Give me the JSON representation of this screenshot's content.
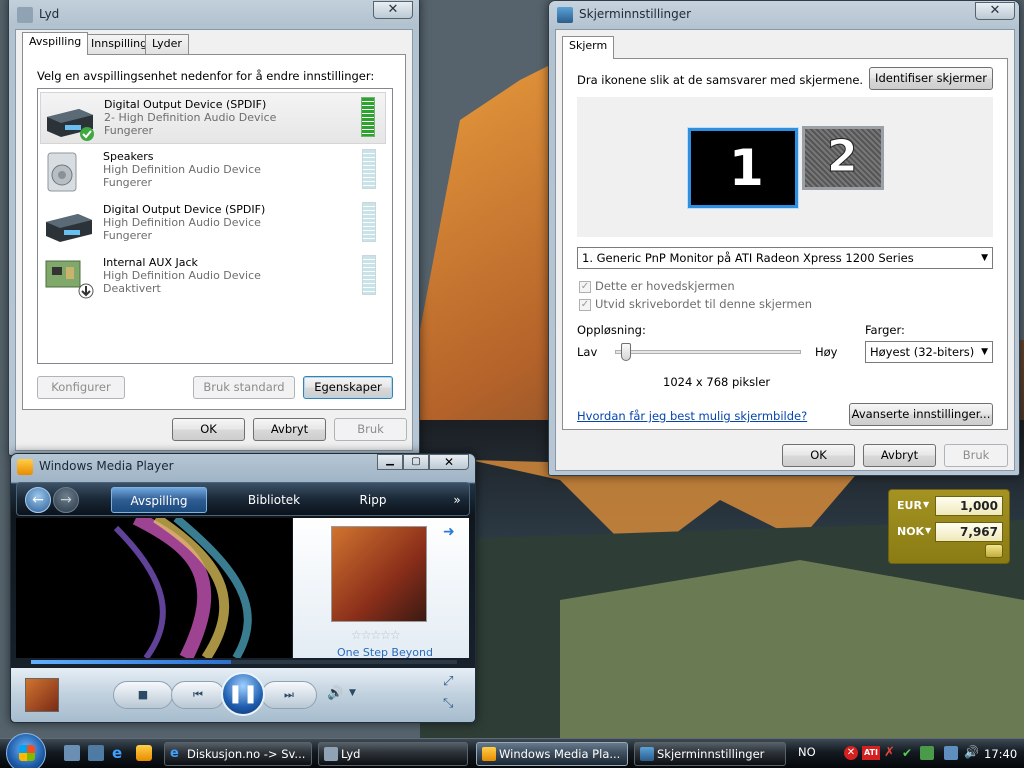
{
  "sound_dialog": {
    "title": "Lyd",
    "tabs": [
      "Avspilling",
      "Innspilling",
      "Lyder"
    ],
    "instruction": "Velg en avspillingsenhet nedenfor for å endre innstillinger:",
    "devices": [
      {
        "name": "Digital Output Device (SPDIF)",
        "desc": "2- High Definition Audio Device",
        "status": "Fungerer",
        "icon": "spdif-device-icon",
        "selected": true,
        "default": true
      },
      {
        "name": "Speakers",
        "desc": "High Definition Audio Device",
        "status": "Fungerer",
        "icon": "speaker-icon"
      },
      {
        "name": "Digital Output Device (SPDIF)",
        "desc": "High Definition Audio Device",
        "status": "Fungerer",
        "icon": "spdif-device-icon"
      },
      {
        "name": "Internal AUX Jack",
        "desc": "High Definition Audio Device",
        "status": "Deaktivert",
        "icon": "sound-card-icon"
      }
    ],
    "buttons": {
      "configure": "Konfigurer",
      "set_default": "Bruk standard",
      "properties": "Egenskaper",
      "ok": "OK",
      "cancel": "Avbryt",
      "apply": "Bruk"
    }
  },
  "display_dialog": {
    "title": "Skjerminnstillinger",
    "tab": "Skjerm",
    "instruction": "Dra ikonene slik at de samsvarer med skjermene.",
    "identify": "Identifiser skjermer",
    "monitor1": "1",
    "monitor2": "2",
    "monitor_select": "1. Generic PnP Monitor på ATI Radeon Xpress 1200 Series",
    "checkbox_primary": "Dette er hovedskjermen",
    "checkbox_extend": "Utvid skrivebordet til denne skjermen",
    "resolution_label": "Oppløsning:",
    "low": "Lav",
    "high": "Høy",
    "resolution_value": "1024 x 768 piksler",
    "resolution_slider_fraction": 0.03,
    "colors_label": "Farger:",
    "colors_value": "Høyest (32-biters)",
    "help_link": "Hvordan får jeg best mulig skjermbilde?",
    "advanced": "Avanserte innstillinger...",
    "buttons": {
      "ok": "OK",
      "cancel": "Avbryt",
      "apply": "Bruk"
    }
  },
  "media_player": {
    "title": "Windows Media Player",
    "nav": [
      "Avspilling",
      "Bibliotek",
      "Ripp"
    ],
    "more": "»",
    "album_caption": "One Step Beyond",
    "rating_stars": 0,
    "progress_fraction": 0.47
  },
  "currency_gadget": {
    "rows": [
      {
        "currency": "EUR",
        "value": "1,000"
      },
      {
        "currency": "NOK",
        "value": "7,967"
      }
    ]
  },
  "taskbar": {
    "buttons": [
      {
        "label": "Diskusjon.no -> Sv...",
        "icon": "internet-explorer-icon"
      },
      {
        "label": "Lyd",
        "icon": "speaker-icon"
      },
      {
        "label": "Windows Media Pla...",
        "icon": "media-player-icon",
        "active": true
      },
      {
        "label": "Skjerminnstillinger",
        "icon": "display-icon"
      }
    ],
    "language": "NO",
    "clock": "17:40"
  },
  "colors": {
    "accent": "#3c7fb1",
    "link": "#0645ad",
    "meter_active": "#2fa32f"
  }
}
